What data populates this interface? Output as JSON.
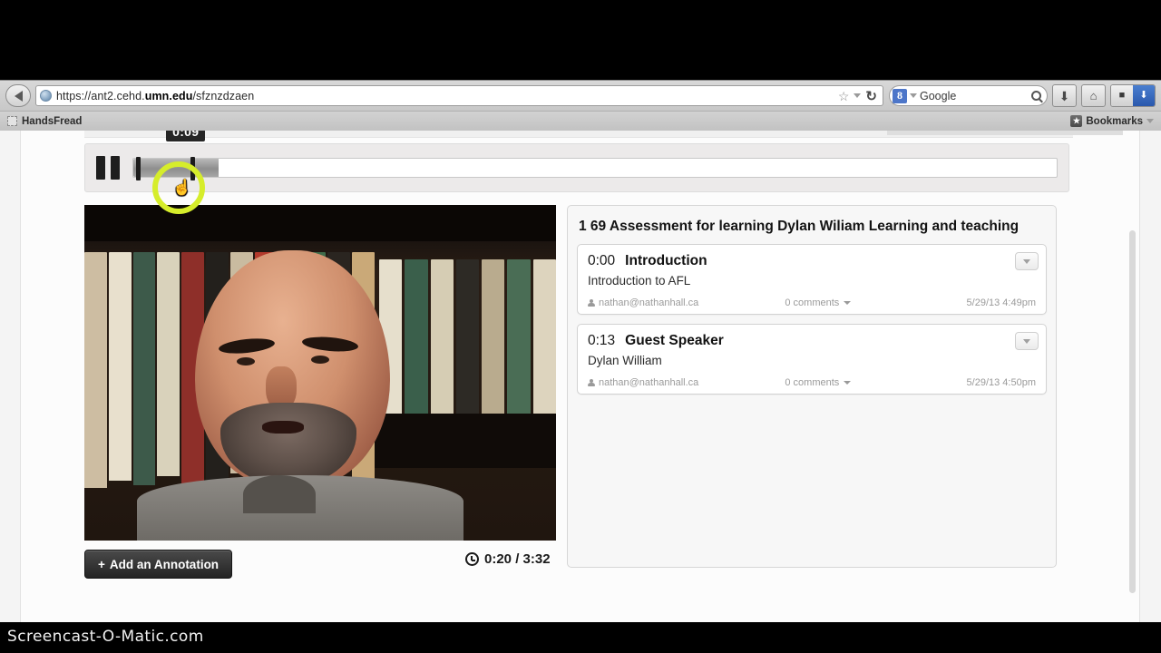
{
  "browser": {
    "back_label": "Back",
    "url": "https://ant2.cehd.",
    "url_bold": "umn.edu",
    "url_tail": "/sfznzdzaen",
    "star_icon": "star-icon",
    "reload_icon": "reload-icon",
    "search_engine": "Google",
    "search_badge": "8",
    "download_icon": "download-icon",
    "home_icon": "home-icon",
    "extension_icon": "extension-icon",
    "bookmark_item": "HandsFread",
    "bookmarks_label": "Bookmarks"
  },
  "player": {
    "pause_icon": "pause-icon",
    "tooltip_time": "0:09",
    "progress_percent": 9.2,
    "markers": [
      {
        "label": "0:00",
        "percent": 0.3
      },
      {
        "label": "0:13",
        "percent": 6.2
      }
    ],
    "add_annotation_label": "Add an Annotation",
    "add_annotation_plus": "+",
    "current_time": "0:20",
    "total_time": "3:32",
    "timecode": "0:20 / 3:32",
    "clock_icon": "clock-icon"
  },
  "annotations": {
    "panel_title": "1 69 Assessment for learning Dylan Wiliam Learning and teaching",
    "items": [
      {
        "time": "0:00",
        "name": "Introduction",
        "description": "Introduction to AFL",
        "author": "nathan@nathanhall.ca",
        "comments": "0 comments",
        "date": "5/29/13 4:49pm",
        "menu_icon": "chevron-down-icon"
      },
      {
        "time": "0:13",
        "name": "Guest Speaker",
        "description": "Dylan William",
        "author": "nathan@nathanhall.ca",
        "comments": "0 comments",
        "date": "5/29/13 4:50pm",
        "menu_icon": "chevron-down-icon"
      }
    ]
  },
  "overlay": {
    "watermark": "Screencast-O-Matic.com",
    "cursor_glyph": "☝",
    "highlight_color": "#d6ed2b"
  }
}
